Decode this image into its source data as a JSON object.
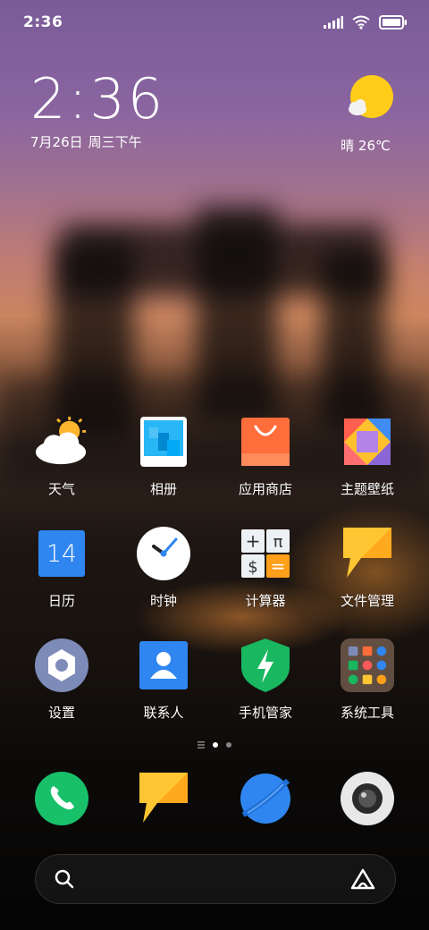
{
  "status_bar": {
    "time": "2:36",
    "icons": [
      "signal-icon",
      "wifi-icon",
      "battery-icon"
    ]
  },
  "clock_widget": {
    "time": "2:36",
    "date": "7月26日",
    "weekday": "周三下午"
  },
  "weather_widget": {
    "condition": "晴",
    "temperature": "26℃",
    "icon": "sun-icon"
  },
  "apps": [
    {
      "label": "天气",
      "icon": "weather-icon"
    },
    {
      "label": "相册",
      "icon": "gallery-icon"
    },
    {
      "label": "应用商店",
      "icon": "app-store-icon"
    },
    {
      "label": "主题壁纸",
      "icon": "themes-icon"
    },
    {
      "label": "日历",
      "icon": "calendar-icon",
      "day": "14"
    },
    {
      "label": "时钟",
      "icon": "clock-icon"
    },
    {
      "label": "计算器",
      "icon": "calculator-icon"
    },
    {
      "label": "文件管理",
      "icon": "file-manager-icon"
    },
    {
      "label": "设置",
      "icon": "settings-icon"
    },
    {
      "label": "联系人",
      "icon": "contacts-icon"
    },
    {
      "label": "手机管家",
      "icon": "security-icon"
    },
    {
      "label": "系统工具",
      "icon": "folder-icon"
    }
  ],
  "page_indicator": {
    "pages": 2,
    "current": 1
  },
  "dock": [
    {
      "icon": "phone-icon"
    },
    {
      "icon": "messages-icon"
    },
    {
      "icon": "browser-icon"
    },
    {
      "icon": "camera-icon"
    }
  ],
  "search_bar": {
    "left_icon": "search-icon",
    "right_icon": "assistant-icon"
  },
  "colors": {
    "accent_blue": "#2f86f0",
    "green": "#18b760",
    "orange": "#ff7a3d",
    "yellow": "#ffc234"
  }
}
